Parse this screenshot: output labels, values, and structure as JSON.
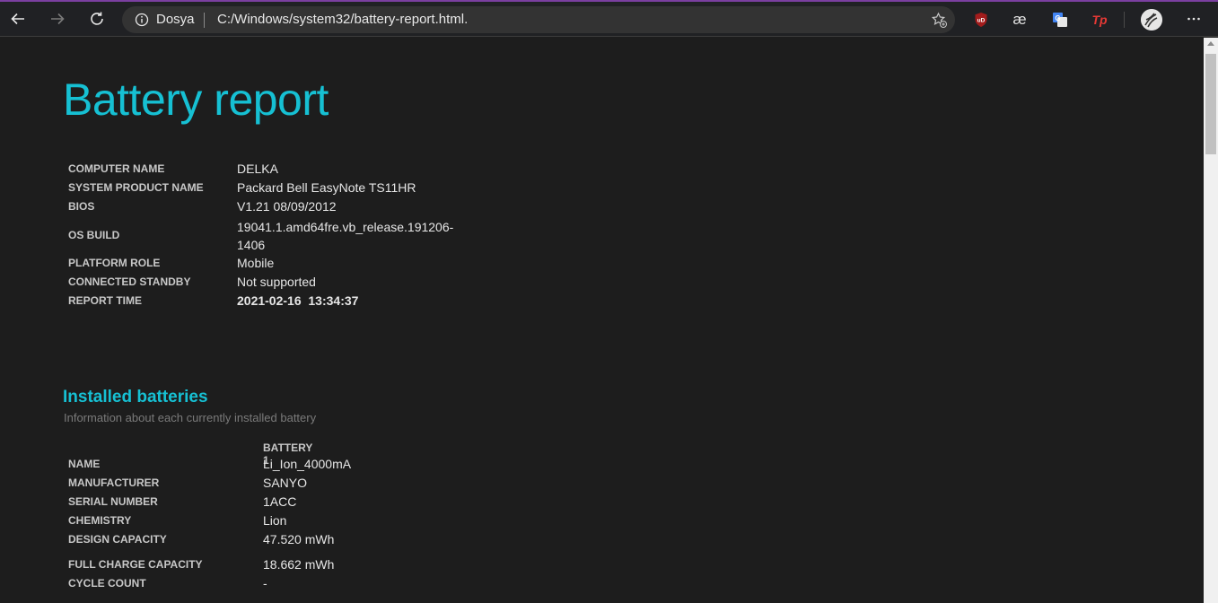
{
  "browser": {
    "site_label": "Dosya",
    "url": "C:/Windows/system32/battery-report.html.",
    "extensions": [
      {
        "name": "ublock-origin-icon",
        "text": "uD",
        "color": "#c0392b"
      },
      {
        "name": "ae-extension-icon",
        "text": "æ",
        "color": "#e0e0e0"
      },
      {
        "name": "google-translate-icon",
        "text": "G",
        "color": "#4285f4"
      },
      {
        "name": "tp-extension-icon",
        "text": "Tp",
        "color": "#e53935"
      }
    ]
  },
  "report": {
    "title": "Battery report",
    "info": [
      {
        "key": "COMPUTER NAME",
        "value": "DELKA"
      },
      {
        "key": "SYSTEM PRODUCT NAME",
        "value": "Packard Bell EasyNote TS11HR"
      },
      {
        "key": "BIOS",
        "value": "V1.21 08/09/2012"
      },
      {
        "key": "OS BUILD",
        "value": "19041.1.amd64fre.vb_release.191206-1406"
      },
      {
        "key": "PLATFORM ROLE",
        "value": "Mobile"
      },
      {
        "key": "CONNECTED STANDBY",
        "value": "Not supported"
      },
      {
        "key": "REPORT TIME",
        "value": "2021-02-16  13:34:37"
      }
    ],
    "installed_batteries": {
      "title": "Installed batteries",
      "description": "Information about each currently installed battery",
      "column_header": "BATTERY 1",
      "rows": [
        {
          "key": "NAME",
          "value": "Li_Ion_4000mA"
        },
        {
          "key": "MANUFACTURER",
          "value": "SANYO"
        },
        {
          "key": "SERIAL NUMBER",
          "value": "1ACC"
        },
        {
          "key": "CHEMISTRY",
          "value": "Lion"
        },
        {
          "key": "DESIGN CAPACITY",
          "value": "47.520 mWh"
        },
        {
          "key": "FULL CHARGE CAPACITY",
          "value": "18.662 mWh"
        },
        {
          "key": "CYCLE COUNT",
          "value": "-"
        }
      ]
    }
  },
  "colors": {
    "accent": "#16c0d3",
    "background": "#1d1d1d",
    "toolbar": "#202124"
  }
}
